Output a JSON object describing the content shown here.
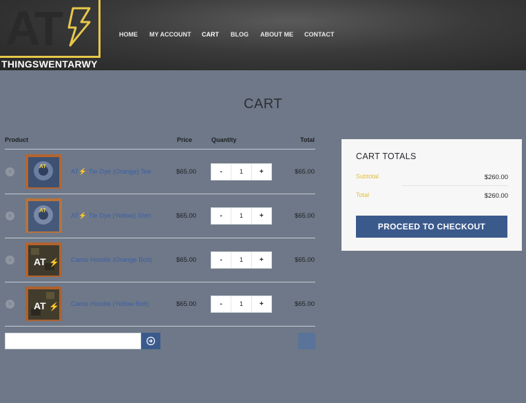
{
  "brand": {
    "logo_text": "AT",
    "name": "THINGSWENTARWY"
  },
  "nav": [
    {
      "label": "HOME"
    },
    {
      "label": "MY ACCOUNT"
    },
    {
      "label": "CART"
    },
    {
      "label": "BLOG"
    },
    {
      "label": "ABOUT ME"
    },
    {
      "label": "CONTACT"
    }
  ],
  "page_title": "CART",
  "table": {
    "headers": {
      "product": "Product",
      "price": "Price",
      "quantity": "Quantity",
      "total": "Total"
    },
    "rows": [
      {
        "name": "AT⚡ Tie Dye (Orange) Tee",
        "price": "$65.00",
        "qty": "1",
        "total": "$65.00",
        "thumb": "tie-dye-orange"
      },
      {
        "name": "AT⚡ Tie Dye (Yellow) Shirt",
        "price": "$65.00",
        "qty": "1",
        "total": "$65.00",
        "thumb": "tie-dye-yellow"
      },
      {
        "name": "Camo Hoodie (Orange Bolt)",
        "price": "$65.00",
        "qty": "1",
        "total": "$65.00",
        "thumb": "camo-orange"
      },
      {
        "name": "Camo Hoodie (Yellow Bolt)",
        "price": "$65.00",
        "qty": "1",
        "total": "$65.00",
        "thumb": "camo-yellow"
      }
    ],
    "qty_minus": "-",
    "qty_plus": "+",
    "remove_symbol": "×"
  },
  "coupon": {
    "placeholder": "",
    "button_icon": "arrow-right-circle-icon"
  },
  "totals": {
    "title": "CART TOTALS",
    "subtotal_label": "Subtotal",
    "subtotal_value": "$260.00",
    "total_label": "Total",
    "total_value": "$260.00",
    "checkout_label": "PROCEED TO CHECKOUT"
  },
  "colors": {
    "accent": "#3b5a8c",
    "brand_yellow": "#e8c84a",
    "link": "#3d5fa3"
  }
}
